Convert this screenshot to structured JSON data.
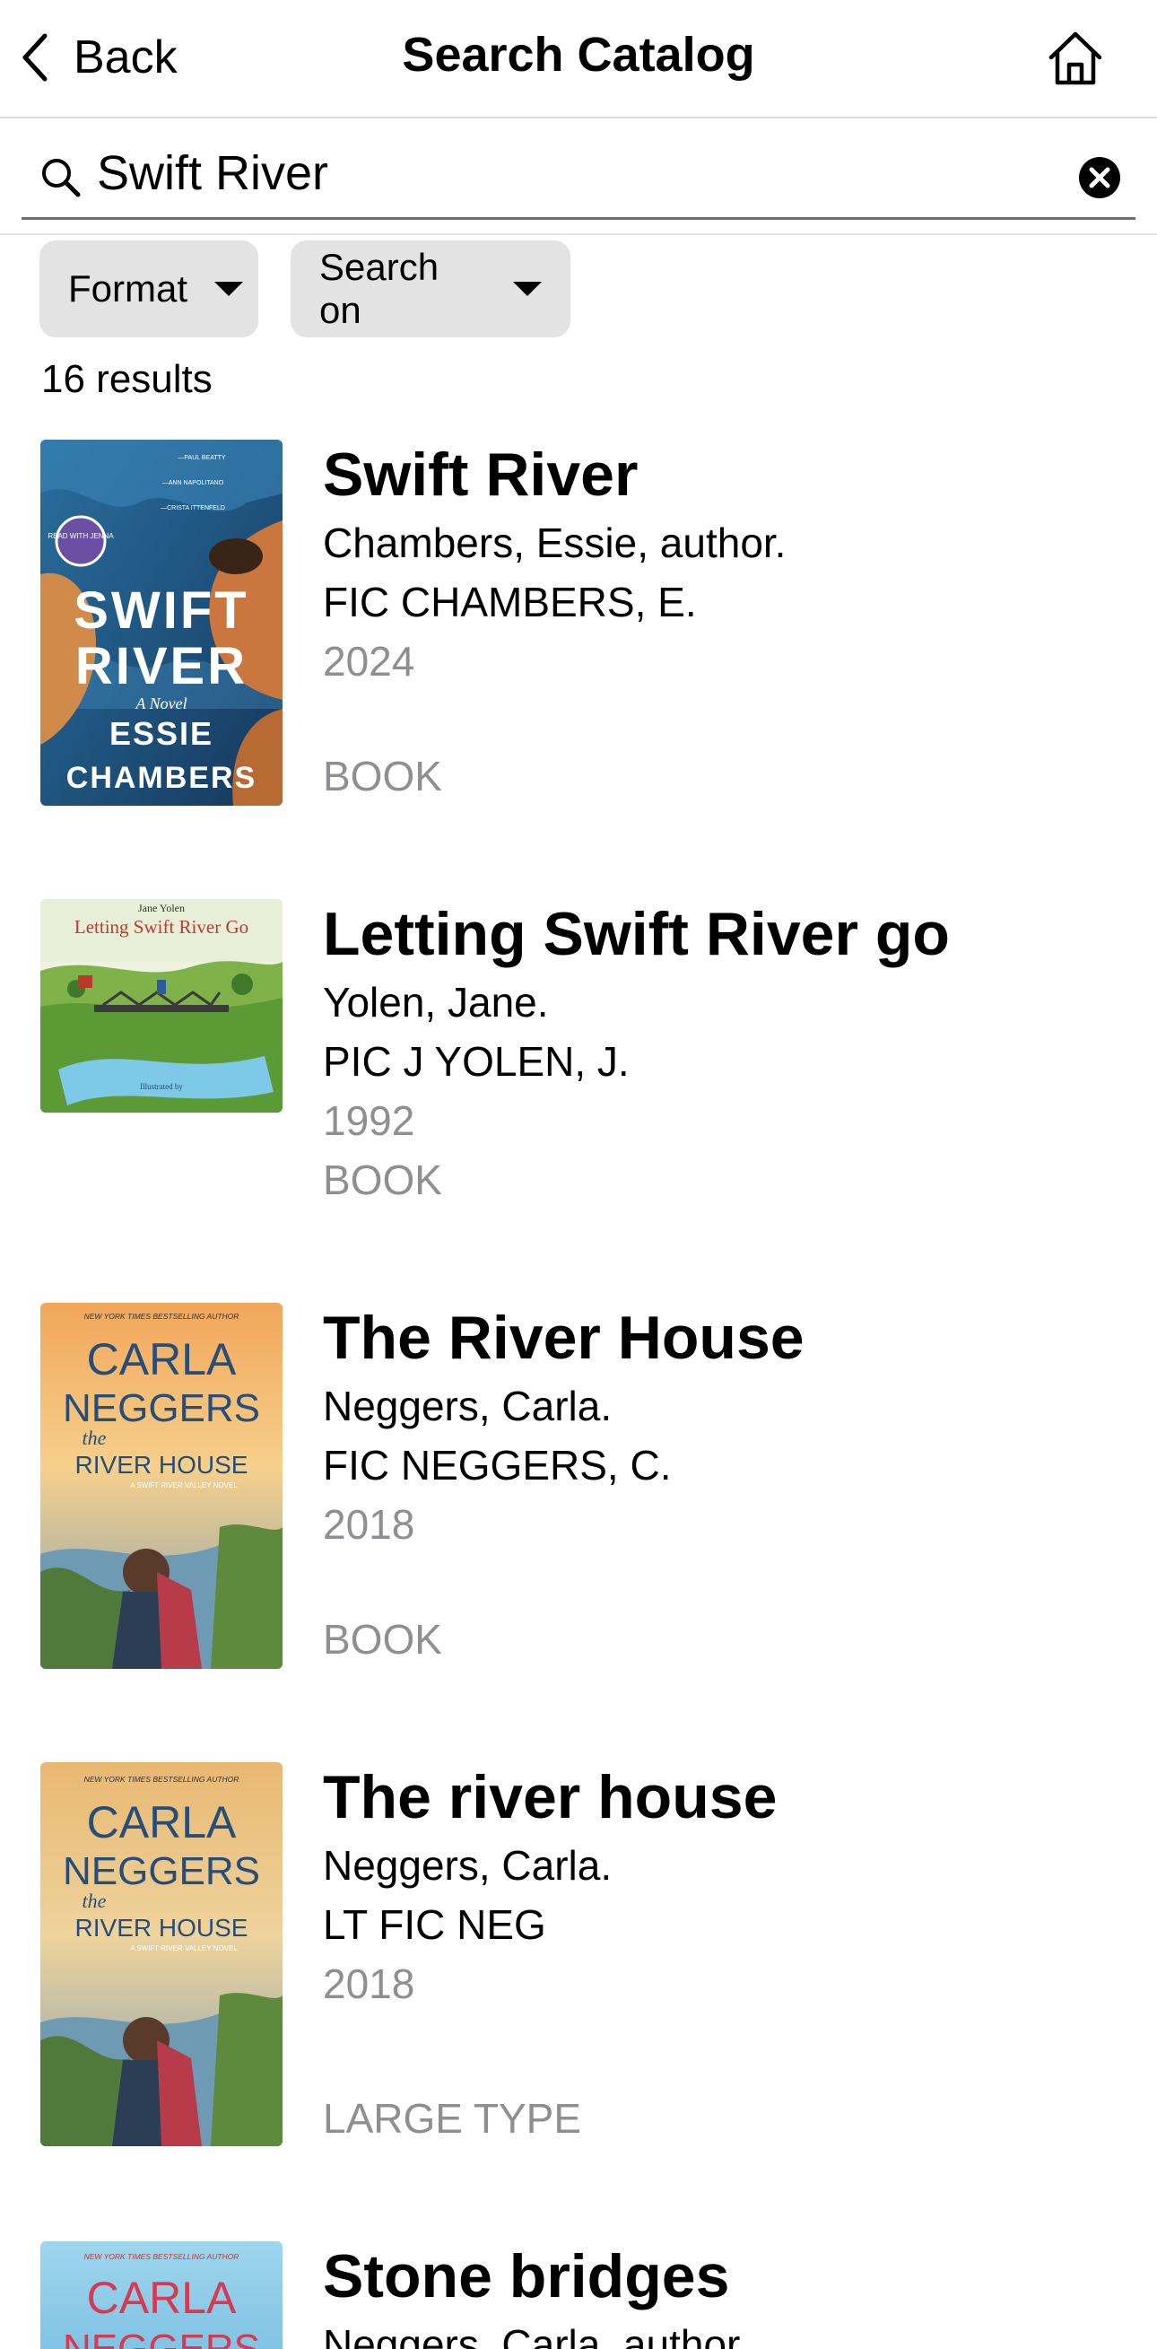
{
  "nav": {
    "back_label": "Back",
    "title": "Search Catalog"
  },
  "search": {
    "value": "Swift River"
  },
  "filters": {
    "format_label": "Format",
    "search_on_label": "Search on"
  },
  "results_count": "16 results",
  "results": [
    {
      "title": "Swift River",
      "author": "Chambers, Essie, author.",
      "call_number": "FIC CHAMBERS, E.",
      "year": "2024",
      "format": "BOOK",
      "cover": {
        "badge": "READ WITH JENNA",
        "title_line1": "SWIFT",
        "title_line2": "RIVER",
        "subtitle": "A Novel",
        "author_line1": "ESSIE",
        "author_line2": "CHAMBERS",
        "quote_credit1": "—PAUL BEATTY",
        "quote_credit2": "—ANN NAPOLITANO",
        "quote_credit3": "—CRISTA ITTENFELD"
      }
    },
    {
      "title": "Letting Swift River go",
      "author": "Yolen, Jane.",
      "call_number": "PIC J YOLEN, J.",
      "year": "1992",
      "format": "BOOK",
      "cover": {
        "author": "Jane Yolen",
        "title": "Letting Swift River Go",
        "illustrated_by": "Illustrated by"
      }
    },
    {
      "title": "The River House",
      "author": "Neggers, Carla.",
      "call_number": "FIC NEGGERS, C.",
      "year": "2018",
      "format": "BOOK",
      "cover": {
        "tagline": "NEW YORK TIMES BESTSELLING AUTHOR",
        "author_line1": "CARLA",
        "author_line2": "NEGGERS",
        "title_small": "the",
        "title_main": "RIVER HOUSE",
        "series": "A SWIFT RIVER VALLEY NOVEL"
      }
    },
    {
      "title": "The river house",
      "author": "Neggers, Carla.",
      "call_number": "LT FIC NEG",
      "year": "2018",
      "format": "LARGE TYPE",
      "cover": {
        "tagline": "NEW YORK TIMES BESTSELLING AUTHOR",
        "author_line1": "CARLA",
        "author_line2": "NEGGERS",
        "title_small": "the",
        "title_main": "RIVER HOUSE",
        "series": "A SWIFT RIVER VALLEY NOVEL"
      }
    },
    {
      "title": "Stone bridges",
      "author": "Neggers, Carla, author.",
      "cover": {
        "tagline": "NEW YORK TIMES BESTSELLING AUTHOR",
        "author_line1": "CARLA",
        "author_line2": "NEGGERS"
      }
    }
  ]
}
